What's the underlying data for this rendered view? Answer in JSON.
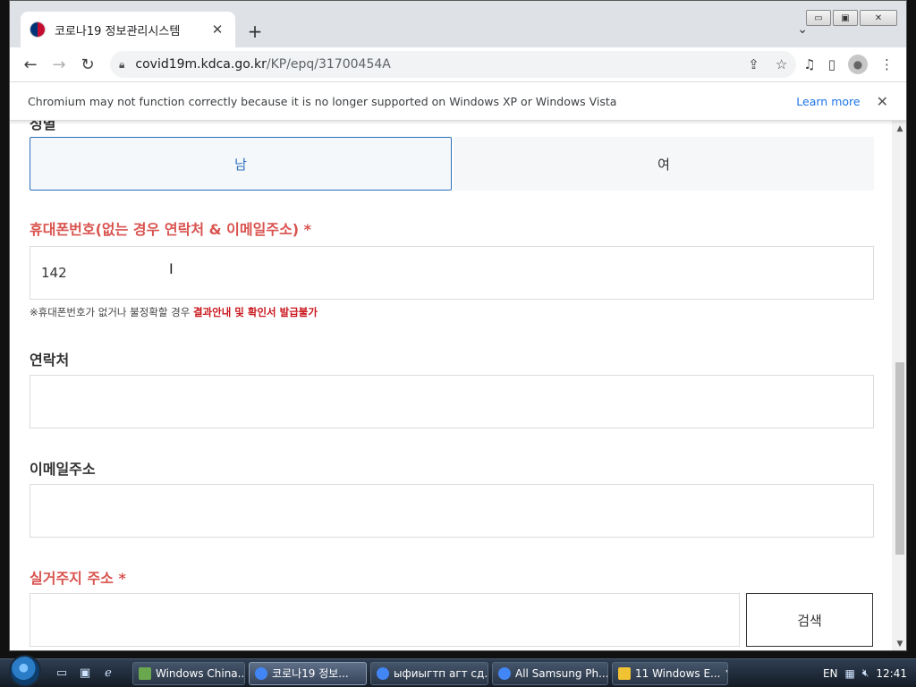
{
  "browser": {
    "tab_title": "코로나19 정보관리시스템",
    "tab_close": "✕",
    "new_tab": "+",
    "tab_search": "⌄",
    "url_host": "covid19m.kdca.go.kr",
    "url_path": "/KP/epq/31700454A",
    "window_min": "▭",
    "window_max": "▣",
    "window_close": "✕"
  },
  "infobar": {
    "message": "Chromium may not function correctly because it is no longer supported on Windows XP or Windows Vista",
    "learn_more": "Learn more",
    "close": "✕"
  },
  "form": {
    "cutoff_label": "성별",
    "gender_options": [
      "남",
      "여"
    ],
    "gender_selected": "남",
    "phone_label": "휴대폰번호(없는 경우 연락처 & 이메일주소) *",
    "phone_value": "142",
    "hint_prefix": "※휴대폰번호가 없거나 불정확할 경우 ",
    "hint_strong": "결과안내 및 확인서 발급불가",
    "contact_label": "연락처",
    "contact_value": "",
    "email_label": "이메일주소",
    "email_value": "",
    "address_label": "실거주지 주소 *",
    "address_value": "",
    "search_button": "검색"
  },
  "taskbar": {
    "tasks": [
      {
        "label": "Windows China...",
        "icon_color": "#6aa84f"
      },
      {
        "label": "코로나19 정보...",
        "icon_color": "#4285f4"
      },
      {
        "label": "ыфиыгтп агт сд...",
        "icon_color": "#4285f4"
      },
      {
        "label": "All Samsung Ph...",
        "icon_color": "#4285f4"
      },
      {
        "label": "11 Windows E...",
        "icon_color": "#f1c232"
      }
    ],
    "language": "EN",
    "clock": "12:41"
  },
  "colors": {
    "required_label": "#d9534f",
    "selected_border": "#2d6fbd",
    "hint_warning": "#c9161d",
    "link": "#1a73e8"
  }
}
